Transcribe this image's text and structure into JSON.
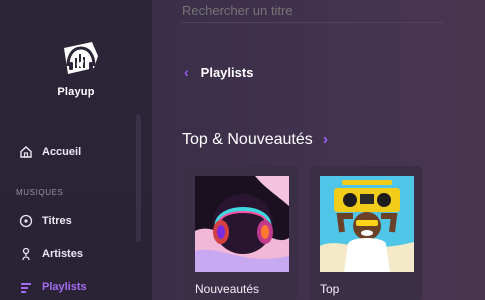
{
  "brand": {
    "name": "Playup"
  },
  "search": {
    "placeholder": "Rechercher un titre"
  },
  "sidebar": {
    "items": [
      {
        "label": "Accueil",
        "icon": "home-icon"
      }
    ],
    "section_label": "MUSIQUES",
    "music_items": [
      {
        "label": "Titres",
        "icon": "music-note-icon"
      },
      {
        "label": "Artistes",
        "icon": "microphone-icon"
      },
      {
        "label": "Playlists",
        "icon": "playlist-icon",
        "active": true
      }
    ]
  },
  "header": {
    "back_label": "Playlists"
  },
  "section": {
    "title": "Top & Nouveautés"
  },
  "cards": [
    {
      "label": "Nouveautés"
    },
    {
      "label": "Top"
    }
  ],
  "colors": {
    "accent": "#9b5cf0",
    "active": "#a56cf2",
    "background": "#2d2438"
  }
}
